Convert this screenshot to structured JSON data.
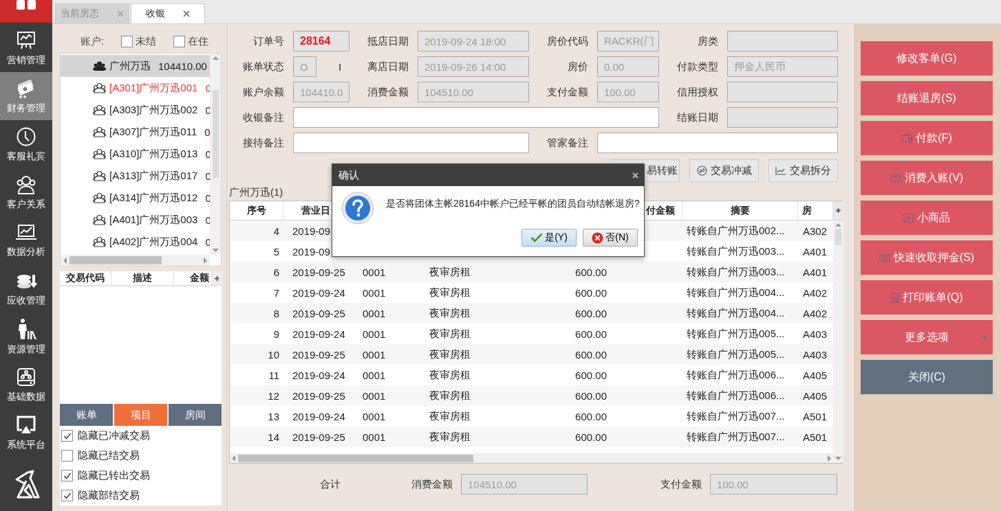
{
  "nav": {
    "items": [
      {
        "label": "营销管理",
        "kind": "marketing",
        "selected": false
      },
      {
        "label": "财务管理",
        "kind": "finance",
        "selected": true
      },
      {
        "label": "客服礼宾",
        "kind": "service",
        "selected": false
      },
      {
        "label": "客户关系",
        "kind": "crm",
        "selected": false
      },
      {
        "label": "数据分析",
        "kind": "analytics",
        "selected": false
      },
      {
        "label": "应收管理",
        "kind": "receivable",
        "selected": false
      },
      {
        "label": "资源管理",
        "kind": "resource",
        "selected": false
      },
      {
        "label": "基础数据",
        "kind": "basedata",
        "selected": false
      },
      {
        "label": "系统平台",
        "kind": "platform",
        "selected": false
      }
    ]
  },
  "tabs": [
    {
      "label": "当前房态",
      "selected": false
    },
    {
      "label": "收银",
      "selected": true
    }
  ],
  "accounts": {
    "label": "账户:",
    "filters": [
      {
        "label": "未结",
        "checked": false
      },
      {
        "label": "在住",
        "checked": false
      }
    ],
    "items": [
      {
        "name": "广州万迅",
        "amount": "104410.00",
        "selected": true,
        "color": "#222222"
      },
      {
        "name": "[A301]广州万迅001",
        "amount": "0",
        "selected": false,
        "color": "#ff2a2a"
      },
      {
        "name": "[A303]广州万迅002",
        "amount": "0",
        "selected": false,
        "color": "#222222"
      },
      {
        "name": "[A307]广州万迅011",
        "amount": "0",
        "selected": false,
        "color": "#222222"
      },
      {
        "name": "[A310]广州万迅013",
        "amount": "0",
        "selected": false,
        "color": "#222222"
      },
      {
        "name": "[A313]广州万迅017",
        "amount": "0",
        "selected": false,
        "color": "#222222"
      },
      {
        "name": "[A314]广州万迅012",
        "amount": "0",
        "selected": false,
        "color": "#222222"
      },
      {
        "name": "[A401]广州万迅003",
        "amount": "0",
        "selected": false,
        "color": "#222222"
      },
      {
        "name": "[A402]广州万迅004",
        "amount": "0",
        "selected": false,
        "color": "#222222"
      }
    ]
  },
  "transactions": {
    "columns": [
      "交易代码",
      "描述",
      "金额"
    ]
  },
  "view_tabs": [
    {
      "label": "账单",
      "selected": false
    },
    {
      "label": "项目",
      "selected": true
    },
    {
      "label": "房间",
      "selected": false
    }
  ],
  "options": [
    {
      "label": "隐藏已冲减交易",
      "checked": true
    },
    {
      "label": "隐藏已结交易",
      "checked": false
    },
    {
      "label": "隐藏已转出交易",
      "checked": true
    },
    {
      "label": "隐藏部结交易",
      "checked": true
    }
  ],
  "form": {
    "fields": [
      {
        "label": "订单号",
        "value": "28164",
        "kind": "highlight"
      },
      {
        "label": "抵店日期",
        "value": "2019-09-24 18:00",
        "kind": "readonly"
      },
      {
        "label": "房价代码",
        "value": "RACKR(门",
        "kind": "readonly"
      },
      {
        "label": "房类",
        "kind": "readonly"
      },
      {
        "label": "账单状态",
        "value": "O",
        "note": "I",
        "kind": "status"
      },
      {
        "label": "离店日期",
        "value": "2019-09-26 14:00",
        "kind": "readonly"
      },
      {
        "label": "房价",
        "value": "0.00",
        "kind": "readonly"
      },
      {
        "label": "付款类型",
        "value": "押金人民币",
        "kind": "readonly"
      },
      {
        "label": "账户余额",
        "value": "104410.0",
        "kind": "readonly"
      },
      {
        "label": "消费金额",
        "value": "104510.00",
        "kind": "readonly"
      },
      {
        "label": "支付金额",
        "value": "100.00",
        "kind": "readonly"
      },
      {
        "label": "信用授权",
        "kind": "readonly"
      },
      {
        "label": "收银备注",
        "kind": "editable"
      },
      {
        "label": "结账日期",
        "kind": "readonly"
      },
      {
        "label": "接待备注",
        "kind": "editable"
      },
      {
        "label": "管家备注",
        "kind": "editable"
      }
    ]
  },
  "toolbar": [
    {
      "label": "易转账",
      "kind": "transfer"
    },
    {
      "label": "交易冲减",
      "kind": "offset"
    },
    {
      "label": "交易拆分",
      "kind": "split"
    }
  ],
  "table": {
    "title": "广州万迅(1)",
    "columns": [
      "序号",
      "营业日",
      "付金额",
      "摘要",
      "房"
    ],
    "rows": [
      {
        "no": "4",
        "date": "2019-09",
        "summary": "转账自广州万迅002...",
        "room": "A302"
      },
      {
        "no": "5",
        "date": "2019-09",
        "summary": "转账自广州万迅003...",
        "room": "A401"
      },
      {
        "no": "6",
        "date": "2019-09-25",
        "code": "0001",
        "item": "夜审房租",
        "amount": "600.00",
        "summary": "转账自广州万迅003...",
        "room": "A401"
      },
      {
        "no": "7",
        "date": "2019-09-24",
        "code": "0001",
        "item": "夜审房租",
        "amount": "600.00",
        "summary": "转账自广州万迅004...",
        "room": "A402"
      },
      {
        "no": "8",
        "date": "2019-09-25",
        "code": "0001",
        "item": "夜审房租",
        "amount": "600.00",
        "summary": "转账自广州万迅004...",
        "room": "A402"
      },
      {
        "no": "9",
        "date": "2019-09-24",
        "code": "0001",
        "item": "夜审房租",
        "amount": "600.00",
        "summary": "转账自广州万迅005...",
        "room": "A403"
      },
      {
        "no": "10",
        "date": "2019-09-25",
        "code": "0001",
        "item": "夜审房租",
        "amount": "600.00",
        "summary": "转账自广州万迅005...",
        "room": "A403"
      },
      {
        "no": "11",
        "date": "2019-09-24",
        "code": "0001",
        "item": "夜审房租",
        "amount": "600.00",
        "summary": "转账自广州万迅006...",
        "room": "A405"
      },
      {
        "no": "12",
        "date": "2019-09-25",
        "code": "0001",
        "item": "夜审房租",
        "amount": "600.00",
        "summary": "转账自广州万迅006...",
        "room": "A405"
      },
      {
        "no": "13",
        "date": "2019-09-24",
        "code": "0001",
        "item": "夜审房租",
        "amount": "600.00",
        "summary": "转账自广州万迅007...",
        "room": "A501"
      },
      {
        "no": "14",
        "date": "2019-09-25",
        "code": "0001",
        "item": "夜审房租",
        "amount": "600.00",
        "summary": "转账自广州万迅007...",
        "room": "A501"
      }
    ]
  },
  "totals": {
    "label": "合计",
    "fields": [
      {
        "label": "消费金额",
        "value": "104510.00"
      },
      {
        "label": "支付金额",
        "value": "100.00"
      }
    ]
  },
  "actions": [
    {
      "label": "修改客单(G)",
      "kind": "plain"
    },
    {
      "label": "结账退房(S)",
      "kind": "plain"
    },
    {
      "label": "付款(F)",
      "kind": "wallet"
    },
    {
      "label": "消费入账(V)",
      "kind": "bill"
    },
    {
      "label": "小商品",
      "kind": "plus"
    },
    {
      "label": "快速收取押金(S)",
      "kind": "cash"
    },
    {
      "label": "打印账单(Q)",
      "kind": "print"
    },
    {
      "label": "更多选项",
      "kind": "menu"
    },
    {
      "label": "关闭(C)",
      "kind": "close"
    }
  ],
  "dialog": {
    "title": "确认",
    "message": "是否将团体主帐28164中帐户已经平帐的团员自动结帐退房?",
    "buttons": [
      {
        "label": "是(Y)",
        "kind": "yes",
        "selected": true
      },
      {
        "label": "否(N)",
        "kind": "no",
        "selected": false
      }
    ]
  }
}
